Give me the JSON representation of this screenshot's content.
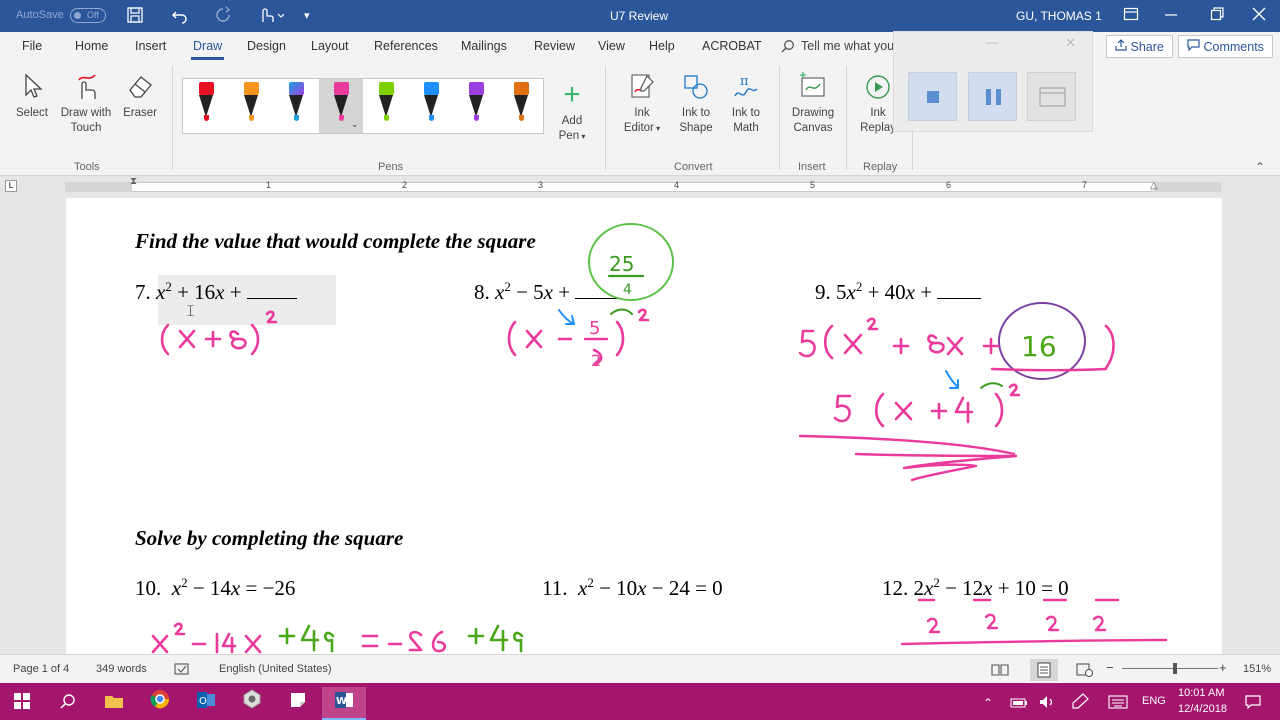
{
  "titlebar": {
    "autosave_label": "AutoSave",
    "autosave_state": "Off",
    "doc_title": "U7 Review",
    "user_name": "GU, THOMAS 1"
  },
  "menu": {
    "items": [
      "File",
      "Home",
      "Insert",
      "Draw",
      "Design",
      "Layout",
      "References",
      "Mailings",
      "Review",
      "View",
      "Help",
      "ACROBAT"
    ],
    "active": "Draw",
    "tell_me": "Tell me what you want to do",
    "share": "Share",
    "comments": "Comments"
  },
  "ribbon": {
    "tools": {
      "select": "Select",
      "draw_with_touch_1": "Draw with",
      "draw_with_touch_2": "Touch",
      "eraser": "Eraser",
      "group": "Tools"
    },
    "pens": {
      "group": "Pens",
      "colors": [
        "#e81123",
        "#f7941d",
        "#1fa0e0",
        "#ea3a9c",
        "#7fd000",
        "#1e90ff",
        "#9b3fe0",
        "#e07010"
      ],
      "selected_index": 3,
      "add_pen_1": "Add",
      "add_pen_2": "Pen"
    },
    "convert": {
      "group": "Convert",
      "ink_editor_1": "Ink",
      "ink_editor_2": "Editor",
      "ink_to_shape_1": "Ink to",
      "ink_to_shape_2": "Shape",
      "ink_to_math_1": "Ink to",
      "ink_to_math_2": "Math"
    },
    "insert": {
      "group": "Insert",
      "drawing_canvas_1": "Drawing",
      "drawing_canvas_2": "Canvas"
    },
    "replay": {
      "group": "Replay",
      "ink_replay_1": "Ink",
      "ink_replay_2": "Replay"
    }
  },
  "ruler": {
    "numbers": [
      "1",
      "1",
      "2",
      "3",
      "4",
      "5",
      "6",
      "7"
    ]
  },
  "document": {
    "heading1": "Find the value that would complete the square",
    "heading2": "Solve by completing the square",
    "p7_num": "7.",
    "p8_num": "8.",
    "p9_num": "9.",
    "p10_num": "10.",
    "p11_num": "11.",
    "p12_num": "12.",
    "ink": {
      "answer8_num": "25",
      "answer8_den": "4",
      "answer9": "16",
      "frac5": "5",
      "frac2": "2"
    }
  },
  "status": {
    "page": "Page 1 of 4",
    "words": "349 words",
    "language": "English (United States)",
    "zoom": "151%"
  },
  "taskbar": {
    "time": "10:01 AM",
    "date": "12/4/2018",
    "lang": "ENG"
  }
}
